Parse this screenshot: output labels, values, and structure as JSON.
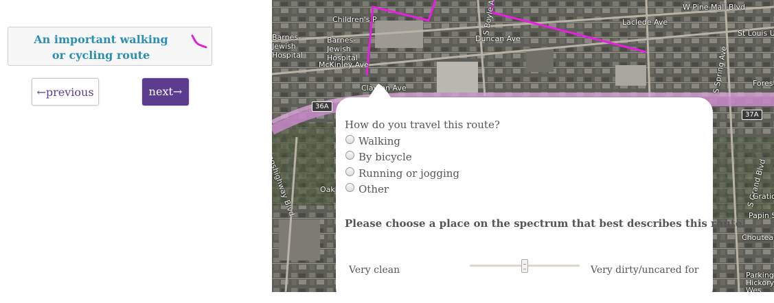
{
  "route_card": {
    "title": "An important walking or cycling route",
    "icon": "route-line-icon",
    "icon_color": "#e020d8"
  },
  "nav": {
    "previous_label": "←previous",
    "next_label": "next→"
  },
  "map": {
    "route_color": "#e81ee0",
    "labels": {
      "childrens": "Children's P",
      "barnes_jewish_hospital": "Barnes-Jewish Hospital",
      "barnes_jewish_short": "Barnes-Jewish Hospital",
      "mckinley": "McKinley Ave",
      "duncan": "Duncan Ave",
      "clayton": "Clayton Ave",
      "laclede": "Laclede Ave",
      "w_pine": "W Pine Mall Blvd",
      "st_louis": "St Louis Ur",
      "forest": "Forest",
      "kingshighway": "Kingshighway Blvd",
      "oakland": "Oakl",
      "s_boyle": "S Boyle Ave",
      "s_grand": "S Grand Blvd",
      "s_spring": "S Spring Ave",
      "gratiot": "Gratiot",
      "papin": "Papin St",
      "chouteau": "Choutea",
      "parking": "Parking Hickory Wes"
    },
    "highways": {
      "left": "36A",
      "right": "37A"
    }
  },
  "form": {
    "question": "How do you travel this route?",
    "options": [
      "Walking",
      "By bicycle",
      "Running or jogging",
      "Other"
    ],
    "selected_option": null,
    "spectrum_question": "Please choose a place on the spectrum that best describes this route.",
    "slider": {
      "left_label": "Very clean",
      "right_label": "Very dirty/uncared for",
      "value": 0.5
    }
  }
}
